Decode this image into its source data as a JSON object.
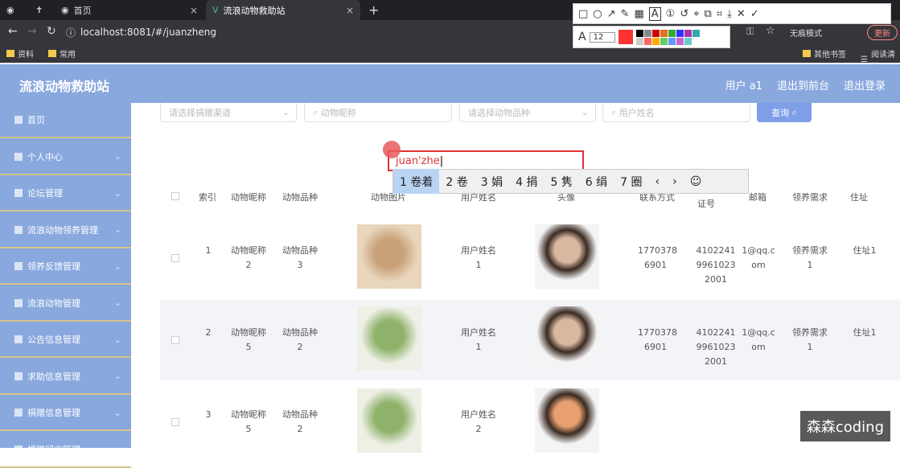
{
  "browser": {
    "tabs": [
      {
        "label": "首页"
      },
      {
        "label": "流浪动物救助站"
      }
    ],
    "url": "localhost:8081/#/juanzheng",
    "bookmarks": [
      "资料",
      "常用",
      "其他书签",
      "阅读清单"
    ],
    "incognito_label": "无痕模式",
    "update_label": "更新"
  },
  "capture_tool": {
    "font_size": "12",
    "font_label": "A",
    "colors": [
      "#f33",
      "#000",
      "#888",
      "#c00",
      "#e07020",
      "#3a3",
      "#33f",
      "#a3a",
      "#3aa",
      "#fff",
      "#ccc",
      "#f66",
      "#fa0",
      "#6c6",
      "#69f",
      "#c6c",
      "#6cc"
    ]
  },
  "header": {
    "title": "流浪动物救助站",
    "user": "用户 a1",
    "back": "退出到前台",
    "logout": "退出登录"
  },
  "sidebar": [
    {
      "label": "首页"
    },
    {
      "label": "个人中心"
    },
    {
      "label": "论坛管理"
    },
    {
      "label": "流浪动物领养管理"
    },
    {
      "label": "领养反馈管理"
    },
    {
      "label": "流浪动物管理"
    },
    {
      "label": "公告信息管理"
    },
    {
      "label": "求助信息管理"
    },
    {
      "label": "捐赠信息管理"
    },
    {
      "label": "捐赠留言管理"
    }
  ],
  "filters": {
    "channel": "请选择捐赠渠道",
    "name": "动物昵称",
    "breed": "请选择动物品种",
    "user": "用户姓名",
    "query": "查询"
  },
  "ime": {
    "typed": "juan'zhe",
    "candidates": [
      "1 卷着",
      "2 卷",
      "3 娟",
      "4 捐",
      "5 隽",
      "6 绢",
      "7 圈"
    ]
  },
  "table": {
    "headers": [
      "索引",
      "动物昵称",
      "动物品种",
      "动物图片",
      "用户姓名",
      "头像",
      "联系方式",
      "证号",
      "邮箱",
      "领养需求",
      "住址"
    ],
    "rows": [
      {
        "idx": "1",
        "name": "动物昵称 2",
        "breed": "动物品种 3",
        "user": "用户姓名 1",
        "phone": "1770378 6901",
        "id": "4102241 9961023 2001",
        "email": "1@qq.c om",
        "need": "领养需求 1",
        "addr": "住址1"
      },
      {
        "idx": "2",
        "name": "动物昵称 5",
        "breed": "动物品种 2",
        "user": "用户姓名 1",
        "phone": "1770378 6901",
        "id": "4102241 9961023 2001",
        "email": "1@qq.c om",
        "need": "领养需求 1",
        "addr": "住址1"
      },
      {
        "idx": "3",
        "name": "动物昵称 5",
        "breed": "动物品种 2",
        "user": "用户姓名 2",
        "phone": "",
        "id": "",
        "email": "",
        "need": "",
        "addr": ""
      }
    ]
  },
  "watermark": "森森coding"
}
